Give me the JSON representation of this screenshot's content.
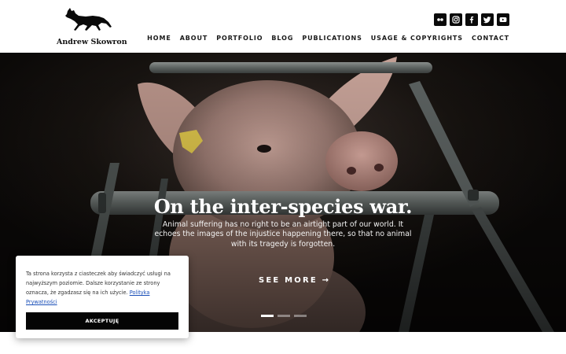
{
  "site": {
    "name": "Andrew Skowron",
    "logo_icon": "fox-icon"
  },
  "social": [
    {
      "name": "flickr-icon"
    },
    {
      "name": "instagram-icon"
    },
    {
      "name": "facebook-icon"
    },
    {
      "name": "twitter-icon"
    },
    {
      "name": "youtube-icon"
    }
  ],
  "nav": {
    "items": [
      "HOME",
      "ABOUT",
      "PORTFOLIO",
      "BLOG",
      "PUBLICATIONS",
      "USAGE & COPYRIGHTS",
      "CONTACT"
    ]
  },
  "hero": {
    "title": "On the inter-species war.",
    "text": "Animal suffering has no right to be an airtight part of our world. It echoes the images of the injustice happening there, so that no animal with its tragedy is forgotten.",
    "cta": "SEE MORE →",
    "slides": 3,
    "active_slide": 1
  },
  "cookie": {
    "text": "Ta strona korzysta z ciasteczek aby świadczyć usługi na najwyższym poziomie. Dalsze korzystanie ze strony oznacza, że zgadzasz się na ich użycie.",
    "link": "Polityka Prywatności",
    "button": "AKCEPTUJĘ"
  },
  "colors": {
    "header_bg": "#ffffff",
    "hero_bg": "#0d0b0a",
    "accent": "#050505",
    "link": "#1a4fb8"
  }
}
